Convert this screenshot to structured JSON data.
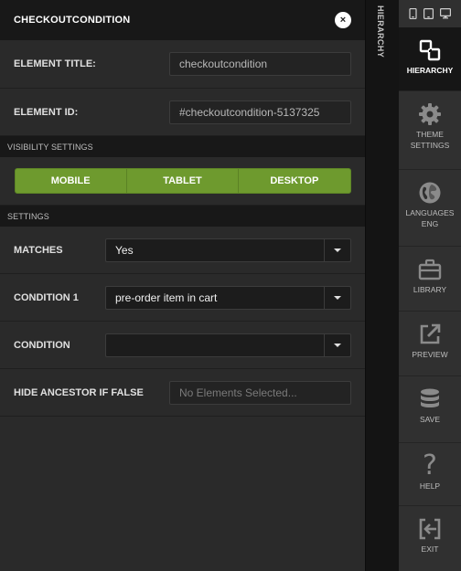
{
  "panel": {
    "title": "CHECKOUTCONDITION",
    "close_label": "×"
  },
  "fields": {
    "element_title": {
      "label": "ELEMENT TITLE:",
      "value": "checkoutcondition"
    },
    "element_id": {
      "label": "ELEMENT ID:",
      "value": "#checkoutcondition-5137325"
    }
  },
  "visibility": {
    "section_title": "VISIBILITY SETTINGS",
    "buttons": [
      "MOBILE",
      "TABLET",
      "DESKTOP"
    ]
  },
  "settings": {
    "section_title": "SETTINGS",
    "matches": {
      "label": "MATCHES",
      "value": "Yes"
    },
    "condition1": {
      "label": "CONDITION 1",
      "value": "pre-order item in cart"
    },
    "condition": {
      "label": "CONDITION",
      "value": ""
    },
    "hide_ancestor": {
      "label": "HIDE ANCESTOR IF FALSE",
      "placeholder": "No Elements Selected..."
    }
  },
  "strip": {
    "label": "HIERARCHY"
  },
  "toolbar": {
    "devices": [
      "mobile-icon",
      "tablet-icon",
      "desktop-icon"
    ],
    "items": [
      {
        "label": "HIERARCHY",
        "icon": "hierarchy-icon",
        "active": true
      },
      {
        "label_line1": "THEME",
        "label_line2": "SETTINGS",
        "icon": "gear-icon"
      },
      {
        "label_line1": "LANGUAGES",
        "label_line2": "ENG",
        "icon": "globe-icon"
      },
      {
        "label": "LIBRARY",
        "icon": "briefcase-icon"
      },
      {
        "label": "PREVIEW",
        "icon": "external-link-icon"
      },
      {
        "label": "SAVE",
        "icon": "database-icon"
      },
      {
        "label": "HELP",
        "icon": "question-icon",
        "glyph": "?"
      },
      {
        "label": "EXIT",
        "icon": "exit-icon"
      }
    ]
  },
  "colors": {
    "accent_green": "#6e9a2e",
    "panel_bg": "#2a2a2a",
    "header_bg": "#181818",
    "toolbar_bg": "#303030"
  }
}
